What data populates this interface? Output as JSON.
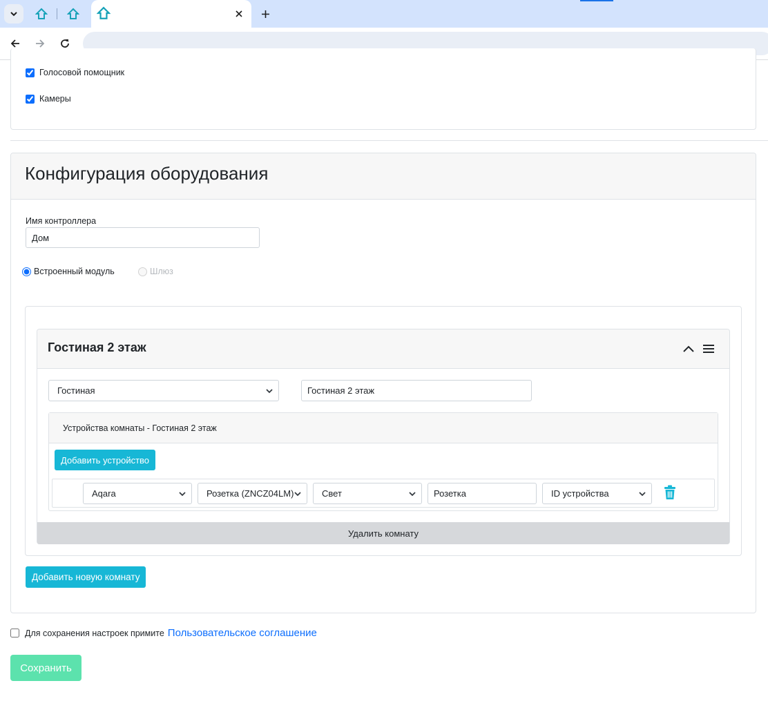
{
  "browser": {
    "address": "",
    "colors": {
      "tabbar": "#d3e3fd",
      "favicon": "#17a2b8"
    }
  },
  "features": {
    "voice_assistant": {
      "label": "Голосовой помощник",
      "checked": true
    },
    "cameras": {
      "label": "Камеры",
      "checked": true
    }
  },
  "config": {
    "title": "Конфигурация оборудования",
    "controller_name_label": "Имя контроллера",
    "controller_name_value": "Дом",
    "mode_options": [
      {
        "label": "Встроенный модуль",
        "selected": true,
        "disabled": false
      },
      {
        "label": "Шлюз",
        "selected": false,
        "disabled": true
      }
    ],
    "room": {
      "title": "Гостиная 2 этаж",
      "type_select": "Гостиная",
      "name_value": "Гостиная 2 этаж",
      "devices_title": "Устройства комнаты - Гостиная 2 этаж",
      "add_device_label": "Добавить устройство",
      "device": {
        "brand": "Aqara",
        "model": "Розетка (ZNCZ04LM)",
        "category": "Свет",
        "name": "Розетка",
        "id_select": "ID устройства"
      },
      "delete_room_label": "Удалить комнату"
    },
    "add_room_label": "Добавить новую комнату"
  },
  "agreement": {
    "text": "Для сохранения настроек примите",
    "link": "Пользовательское соглашение",
    "checked": false
  },
  "save_label": "Сохранить",
  "colors": {
    "info": "#17b7d6",
    "save": "#5ce2ad",
    "link": "#0d6efd",
    "delete": "#17b7d6"
  }
}
